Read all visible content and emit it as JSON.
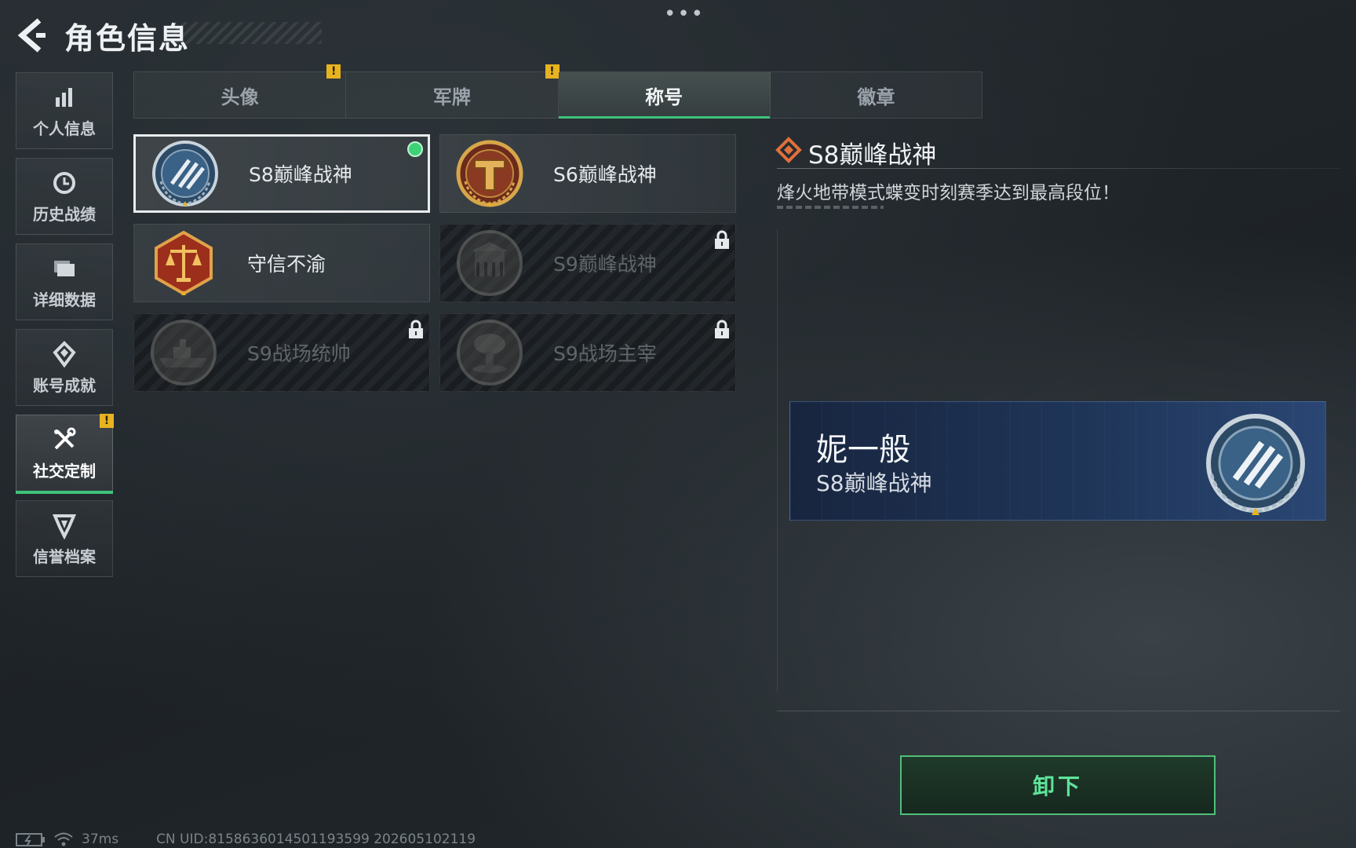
{
  "header": {
    "title": "角色信息",
    "back_icon": "chevron-left-icon",
    "more_icon": "more-dots-icon",
    "more_glyph": "•••"
  },
  "sidebar": {
    "items": [
      {
        "label": "个人信息",
        "icon": "bar-chart-icon",
        "active": false
      },
      {
        "label": "历史战绩",
        "icon": "history-clock-icon",
        "active": false
      },
      {
        "label": "详细数据",
        "icon": "folder-icon",
        "active": false
      },
      {
        "label": "账号成就",
        "icon": "achievement-icon",
        "active": false
      },
      {
        "label": "社交定制",
        "icon": "tools-icon",
        "active": true,
        "badge": "!"
      },
      {
        "label": "信誉档案",
        "icon": "reputation-icon",
        "active": false
      }
    ]
  },
  "tabs": [
    {
      "label": "头像",
      "active": false,
      "badge": "!"
    },
    {
      "label": "军牌",
      "active": false,
      "badge": "!"
    },
    {
      "label": "称号",
      "active": true
    },
    {
      "label": "徽章",
      "active": false
    }
  ],
  "titles": [
    {
      "label": "S8巅峰战神",
      "emblem": "blue-laurel-emblem",
      "selected": true,
      "locked": false
    },
    {
      "label": "S6巅峰战神",
      "emblem": "bronze-t-emblem",
      "selected": false,
      "locked": false
    },
    {
      "label": "守信不渝",
      "emblem": "scales-emblem",
      "selected": false,
      "locked": false
    },
    {
      "label": "S9巅峰战神",
      "emblem": "building-emblem",
      "selected": false,
      "locked": true
    },
    {
      "label": "S9战场统帅",
      "emblem": "warship-emblem",
      "selected": false,
      "locked": true
    },
    {
      "label": "S9战场主宰",
      "emblem": "mushroom-cloud-emblem",
      "selected": false,
      "locked": true
    }
  ],
  "detail": {
    "title": "S8巅峰战神",
    "description": "烽火地带模式蝶变时刻赛季达到最高段位！"
  },
  "preview": {
    "player_name": "妮一般",
    "title": "S8巅峰战神"
  },
  "actions": {
    "unequip_label": "卸下"
  },
  "footer": {
    "ping": "37ms",
    "uid": "CN UID:8158636014501193599 202605102119"
  },
  "colors": {
    "accent_green": "#3ec27a",
    "warning_yellow": "#e8b321",
    "banner_blue": "#1f3558"
  }
}
